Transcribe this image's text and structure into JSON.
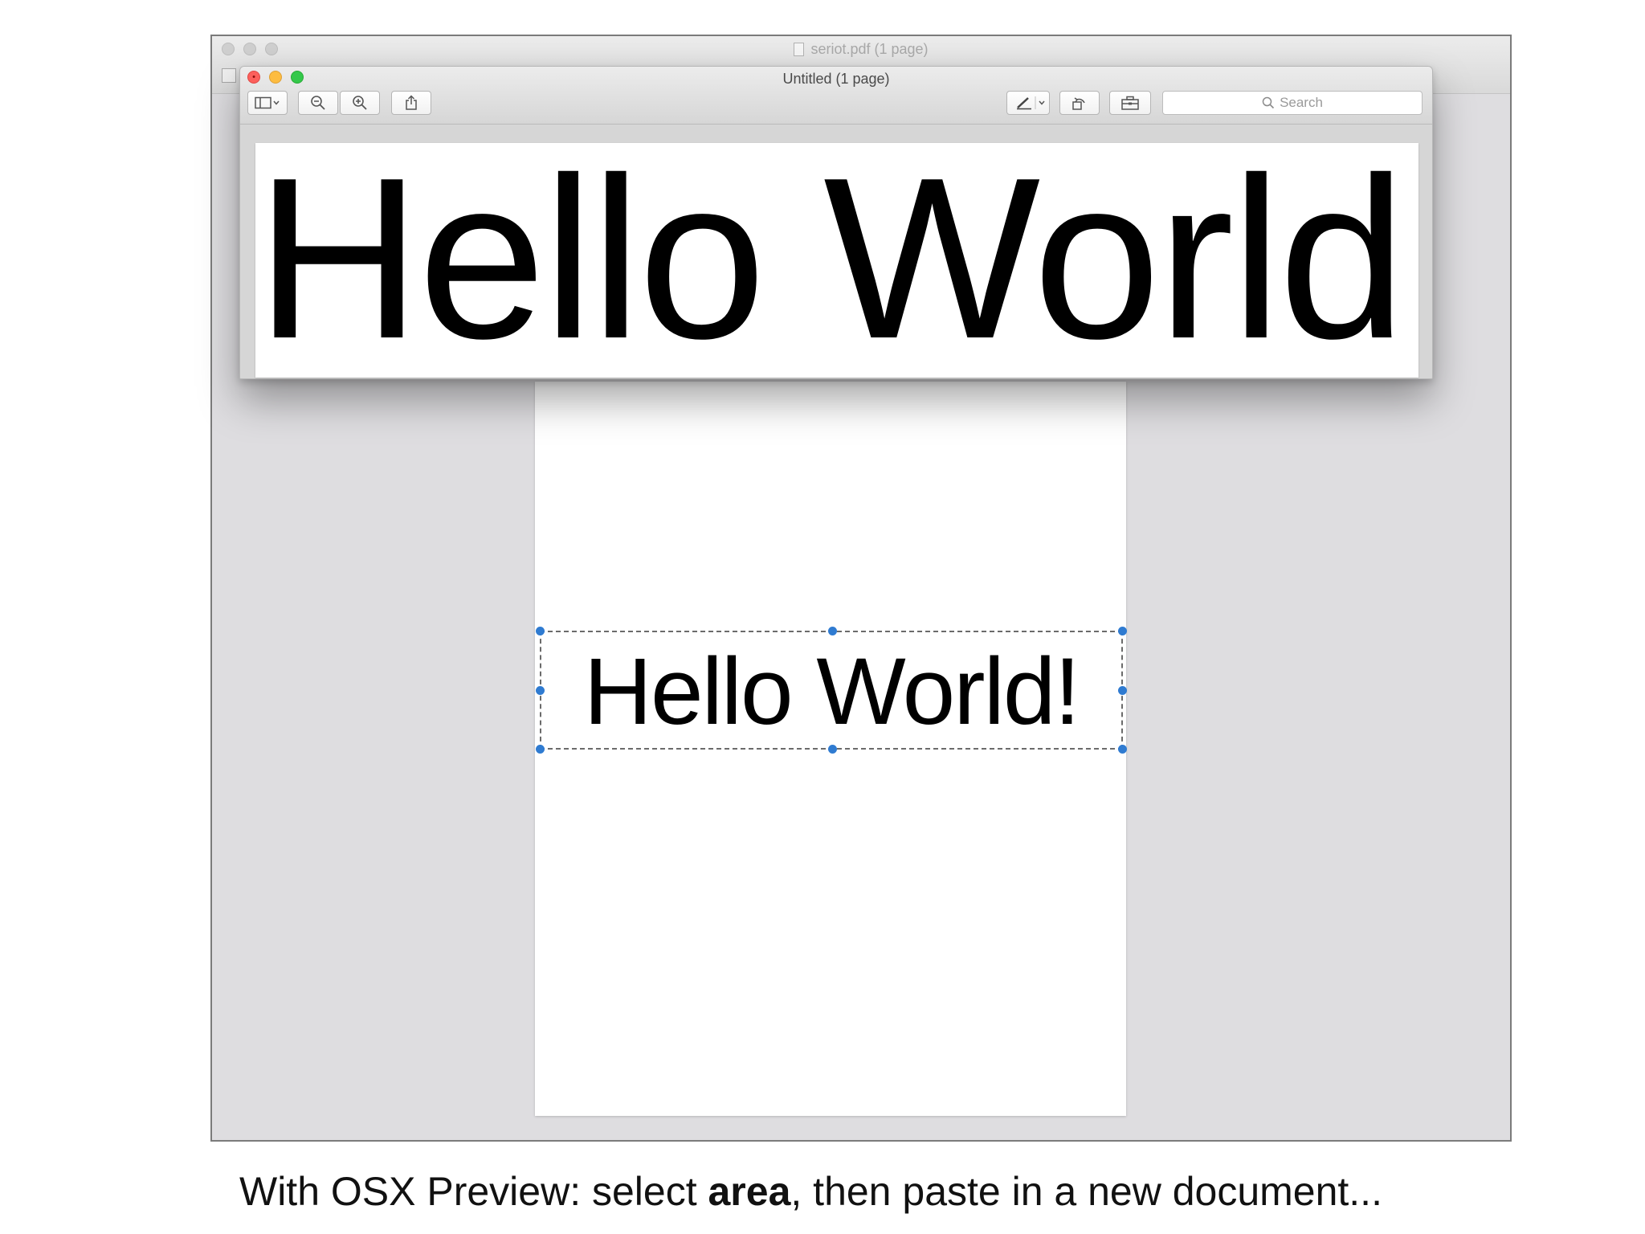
{
  "back_window": {
    "title": "seriot.pdf (1 page)",
    "page_text": "Hello World!"
  },
  "front_window": {
    "title": "Untitled (1 page)",
    "search": {
      "placeholder": "Search"
    },
    "page_text": "Hello World!",
    "toolbar_icons": [
      "sidebar-icon",
      "zoom-out-icon",
      "zoom-in-icon",
      "share-icon",
      "markup-pen-icon",
      "rotate-icon",
      "toolbox-icon"
    ]
  },
  "caption": {
    "prefix": "With OSX Preview: select ",
    "bold": "area",
    "suffix": ", then paste in a new document..."
  },
  "colors": {
    "selection_handle": "#2f7bd1",
    "close_light": "#fc605c",
    "minimize_light": "#fdbc40",
    "maximize_light": "#34c84a",
    "window_background": "#dedde0"
  }
}
